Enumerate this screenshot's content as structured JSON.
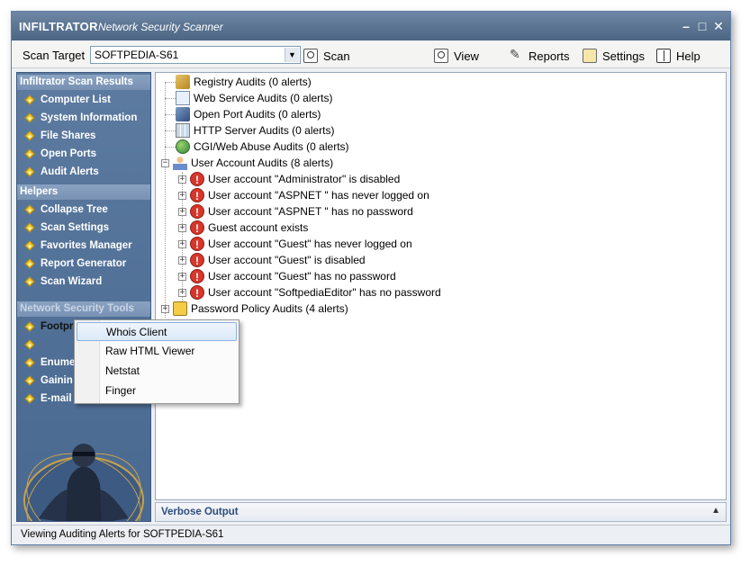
{
  "window": {
    "app_name": "INFILTRATOR",
    "subtitle": "Network Security Scanner",
    "buttons": {
      "minimize": "–",
      "maximize": "□",
      "close": "✕"
    }
  },
  "toolbar": {
    "scan_target_label": "Scan Target",
    "scan_target_value": "SOFTPEDIA-S61",
    "scan": "Scan",
    "view": "View",
    "reports": "Reports",
    "settings": "Settings",
    "help": "Help"
  },
  "sidebar": {
    "scan_results_header": "Infiltrator Scan Results",
    "scan_results": [
      "Computer List",
      "System Information",
      "File Shares",
      "Open Ports",
      "Audit Alerts"
    ],
    "helpers_header": "Helpers",
    "helpers": [
      "Collapse Tree",
      "Scan Settings",
      "Favorites Manager",
      "Report Generator",
      "Scan Wizard"
    ],
    "tools_header": "Network Security Tools",
    "tools": [
      "Footprinting",
      "",
      "Enume",
      "Gainin",
      "E-mail"
    ]
  },
  "tree": {
    "items": [
      "Registry Audits (0 alerts)",
      "Web Service Audits (0 alerts)",
      "Open Port Audits (0 alerts)",
      "HTTP Server Audits (0 alerts)",
      "CGI/Web Abuse Audits (0 alerts)",
      "User Account Audits (8 alerts)"
    ],
    "user_alerts": [
      "User account \"Administrator\" is disabled",
      "User account \"ASPNET \" has never logged on",
      "User account \"ASPNET \" has no password",
      "Guest account exists",
      "User account \"Guest\" has never logged on",
      "User account \"Guest\" is disabled",
      "User account \"Guest\" has no password",
      "User account \"SoftpediaEditor\" has no password"
    ],
    "password_policy": "Password Policy Audits (4 alerts)"
  },
  "context_menu": {
    "items": [
      "Whois Client",
      "Raw HTML Viewer",
      "Netstat",
      "Finger"
    ],
    "highlighted": "Whois Client"
  },
  "verbose_output": "Verbose Output",
  "status": "Viewing Auditing Alerts for SOFTPEDIA-S61"
}
